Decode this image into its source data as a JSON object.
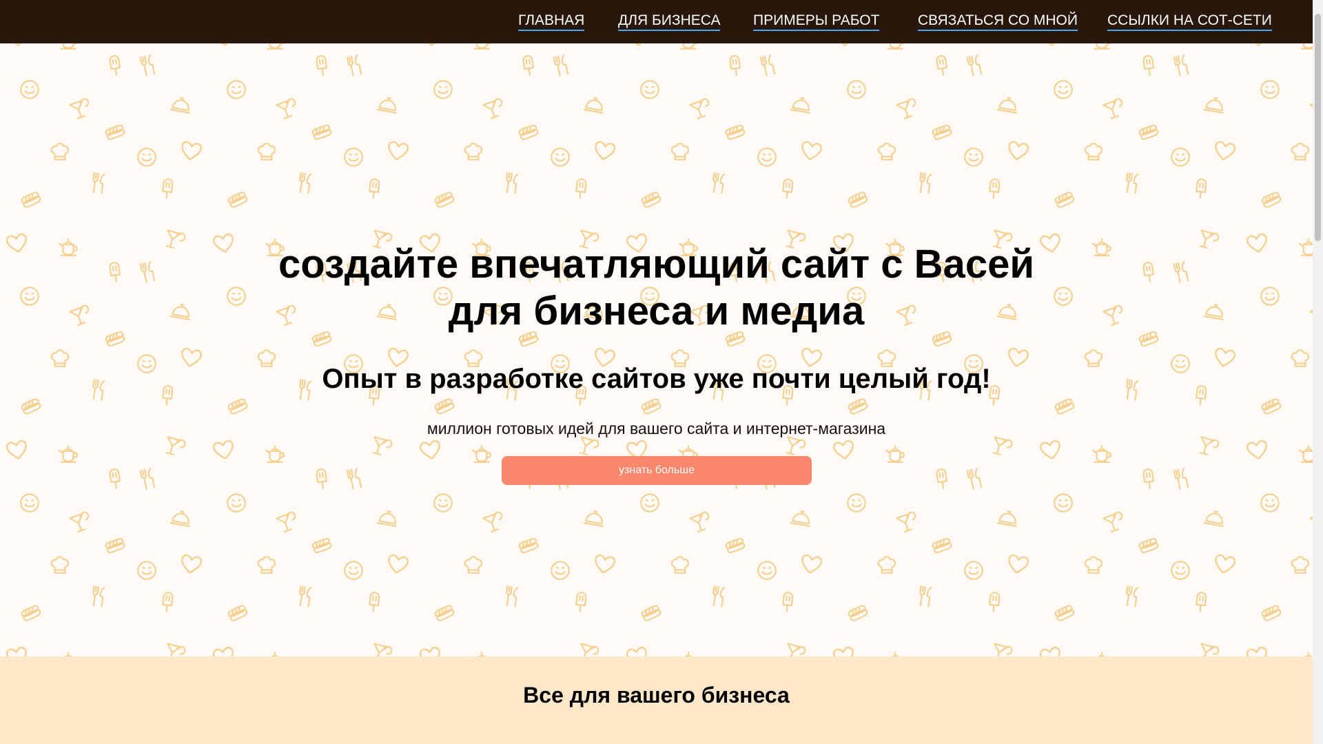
{
  "nav": {
    "items": [
      {
        "label": "ГЛАВНАЯ"
      },
      {
        "label": "ДЛЯ БИЗНЕСА"
      },
      {
        "label": "ПРИМЕРЫ РАБОТ"
      },
      {
        "label": "СВЯЗАТЬСЯ СО МНОЙ"
      },
      {
        "label": "ССЫЛКИ НА СОТ-СЕТИ"
      }
    ]
  },
  "hero": {
    "title_line1": "создайте впечатляющий сайт с Васей",
    "title_line2": "для бизнеса и медиа",
    "subtitle": "Опыт в разработке сайтов уже почти целый год!",
    "text": "миллион готовых идей для вашего сайта и интернет-магазина",
    "button_label": "узнать больше"
  },
  "business": {
    "title": "Все для вашего бизнеса"
  },
  "colors": {
    "nav_bg": "#2a170c",
    "nav_underline": "#4aa8ff",
    "hero_bg": "#fffaf6",
    "pattern_icon": "#f6cf8e",
    "button_bg": "#f8876b",
    "business_bg": "#ffe8c9"
  },
  "pattern_icons": [
    "heart-icon",
    "teapot-icon",
    "cocktail-icon",
    "popsicle-icon",
    "fork-knife-icon",
    "smiley-icon",
    "hotdog-icon",
    "chef-hat-icon",
    "cloche-icon"
  ]
}
